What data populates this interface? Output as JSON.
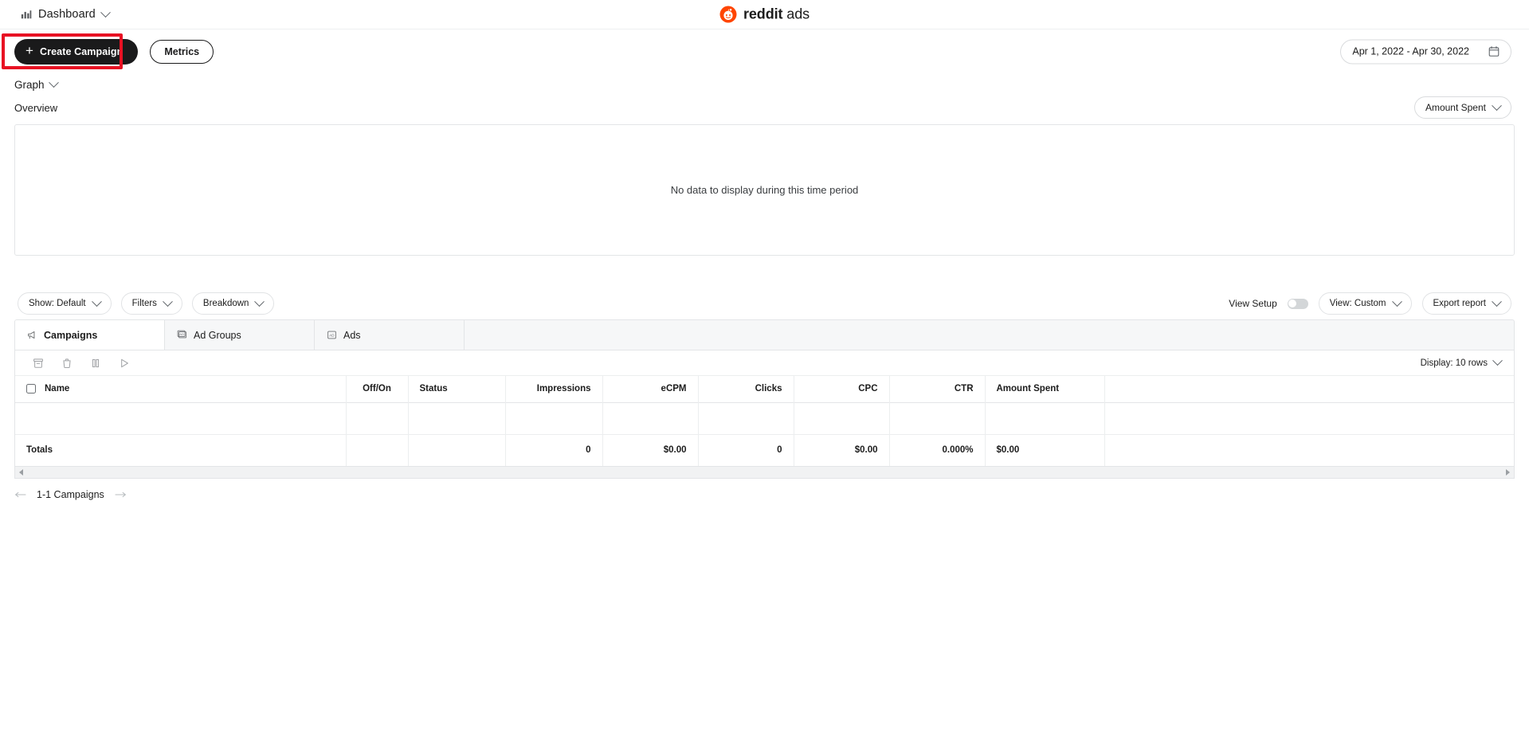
{
  "topbar": {
    "nav_label": "Dashboard",
    "nav_icon": "bar-chart-icon",
    "nav_chevron_icon": "chevron-down-icon",
    "brand_name_bold": "reddit",
    "brand_name_light": " ads",
    "brand_icon": "reddit-snoo-icon"
  },
  "actionbar": {
    "create_label": "Create Campaign",
    "create_plus_icon": "plus-icon",
    "metrics_label": "Metrics",
    "date_range": "Apr 1, 2022 - Apr 30, 2022",
    "calendar_icon": "calendar-icon",
    "highlight_color": "#e81123"
  },
  "graph": {
    "section_label": "Graph",
    "overview_label": "Overview",
    "metric_pill_label": "Amount Spent",
    "empty_message": "No data to display during this time period"
  },
  "filters": {
    "show_label": "Show: Default",
    "filters_label": "Filters",
    "breakdown_label": "Breakdown",
    "view_setup_label": "View Setup",
    "view_setup_on": false,
    "view_label": "View: Custom",
    "export_label": "Export report"
  },
  "tabs": [
    {
      "label": "Campaigns",
      "icon": "megaphone-icon",
      "active": true
    },
    {
      "label": "Ad Groups",
      "icon": "ad-group-icon",
      "active": false
    },
    {
      "label": "Ads",
      "icon": "ad-icon",
      "active": false
    }
  ],
  "table_toolbar": {
    "archive_icon": "archive-icon",
    "delete_icon": "trash-icon",
    "pause_icon": "pause-icon",
    "play_icon": "play-icon",
    "display_rows_label": "Display: 10 rows"
  },
  "table": {
    "headers": {
      "name": "Name",
      "off_on": "Off/On",
      "status": "Status",
      "impressions": "Impressions",
      "ecpm": "eCPM",
      "clicks": "Clicks",
      "cpc": "CPC",
      "ctr": "CTR",
      "amount_spent": "Amount Spent"
    },
    "totals": {
      "label": "Totals",
      "off_on": "",
      "status": "",
      "impressions": "0",
      "ecpm": "$0.00",
      "clicks": "0",
      "cpc": "$0.00",
      "ctr": "0.000%",
      "amount_spent": "$0.00"
    }
  },
  "pager": {
    "prev_icon": "arrow-left-icon",
    "range_label": "1-1 Campaigns",
    "next_icon": "arrow-right-icon"
  }
}
